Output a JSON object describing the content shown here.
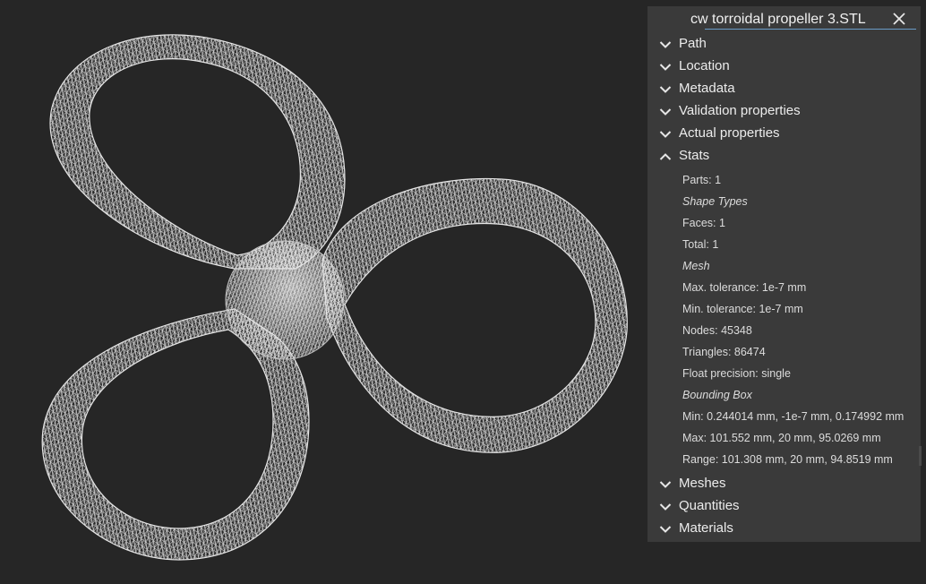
{
  "window": {
    "title": "cw torroidal propeller 3.STL"
  },
  "icons": {
    "close": "close-icon",
    "collapsed": "chevron-down-icon",
    "expanded": "chevron-up-icon"
  },
  "colors": {
    "background": "#262626",
    "panel": "#3a3a3a",
    "mesh": "#d8d8d8",
    "title_underline": "#6a9cc8"
  },
  "sections_top": [
    {
      "label": "Path",
      "expanded": false
    },
    {
      "label": "Location",
      "expanded": false
    },
    {
      "label": "Metadata",
      "expanded": false
    },
    {
      "label": "Validation properties",
      "expanded": false
    },
    {
      "label": "Actual properties",
      "expanded": false
    },
    {
      "label": "Stats",
      "expanded": true
    }
  ],
  "stats": {
    "parts": "Parts: 1",
    "shape_types_heading": "Shape Types",
    "faces": "Faces: 1",
    "total": "Total: 1",
    "mesh_heading": "Mesh",
    "max_tolerance": "Max. tolerance: 1e-7 mm",
    "min_tolerance": "Min. tolerance: 1e-7 mm",
    "nodes": "Nodes: 45348",
    "triangles": "Triangles: 86474",
    "float_precision": "Float precision: single",
    "bounding_box_heading": "Bounding Box",
    "bbox_min": "Min: 0.244014 mm, -1e-7 mm, 0.174992 mm",
    "bbox_max": "Max: 101.552 mm, 20 mm, 95.0269 mm",
    "bbox_range": "Range: 101.308 mm, 20 mm, 94.8519 mm"
  },
  "sections_bottom": [
    {
      "label": "Meshes",
      "expanded": false
    },
    {
      "label": "Quantities",
      "expanded": false
    },
    {
      "label": "Materials",
      "expanded": false
    }
  ]
}
